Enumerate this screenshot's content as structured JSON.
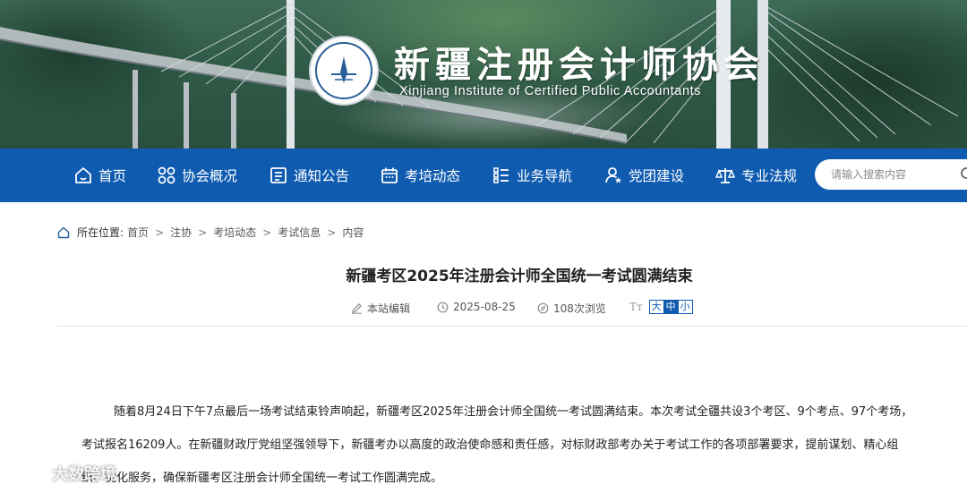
{
  "header": {
    "title": "新疆注册会计师协会",
    "subtitle": "Xinjiang Institute of Certified Public Accountants",
    "logo_icon": "association-seal-icon"
  },
  "nav": {
    "items": [
      {
        "label": "首页",
        "icon": "home-icon"
      },
      {
        "label": "协会概况",
        "icon": "grid-circles-icon"
      },
      {
        "label": "通知公告",
        "icon": "notice-board-icon"
      },
      {
        "label": "考培动态",
        "icon": "calendar-icon"
      },
      {
        "label": "业务导航",
        "icon": "list-icon"
      },
      {
        "label": "党团建设",
        "icon": "person-star-icon"
      },
      {
        "label": "专业法规",
        "icon": "scales-icon"
      }
    ],
    "search": {
      "placeholder": "请输入搜索内容"
    }
  },
  "breadcrumb": {
    "label": "所在位置:",
    "items": [
      "首页",
      "注协",
      "考培动态",
      "考试信息",
      "内容"
    ],
    "separator": ">"
  },
  "article": {
    "title": "新疆考区2025年注册会计师全国统一考试圆满结束",
    "author": "本站编辑",
    "date": "2025-08-25",
    "views": "108次浏览",
    "font_size_label": "Tт",
    "font_sizes": [
      "大",
      "中",
      "小"
    ],
    "selected_font_size": "中",
    "paragraph_lines": [
      "随着8月24日下午7点最后一场考试结束铃声响起，新疆考区2025年注册会计师全国统一考试圆满结束。本次考试全疆共设3个考区、9个考点、97个考场，",
      "考试报名16209人。在新疆财政厅党组坚强领导下，新疆考办以高度的政治使命感和责任感，对标财政部考办关于考试工作的各项部署要求，提前谋划、精心组",
      "织、优化服务，确保新疆考区注册会计师全国统一考试工作圆满完成。"
    ]
  },
  "watermark": {
    "text": "大数跨境"
  },
  "colors": {
    "nav_bg": "#0f5bb0",
    "accent": "#0f5bb0",
    "text": "#222222"
  }
}
